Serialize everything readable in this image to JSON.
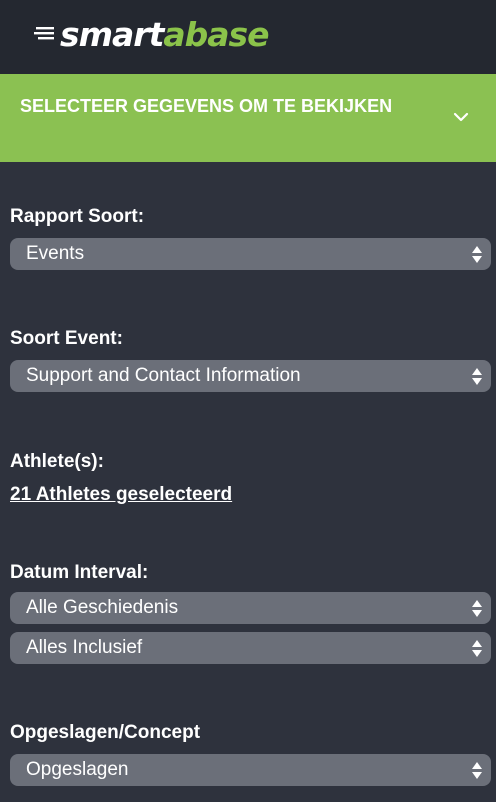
{
  "app": {
    "logo_part1": "smart",
    "logo_part2": "abase",
    "brand_color": "#8bc34a"
  },
  "banner": {
    "title": "SELECTEER GEGEVENS OM TE BEKIJKEN",
    "icon": "chevron-down-icon"
  },
  "form": {
    "report_type": {
      "label": "Rapport Soort:",
      "value": "Events"
    },
    "event_type": {
      "label": "Soort Event:",
      "value": "Support and Contact Information"
    },
    "athletes": {
      "label": "Athlete(s):",
      "link": "21 Athletes geselecteerd"
    },
    "date_interval": {
      "label": "Datum Interval:",
      "range_value": "Alle Geschiedenis",
      "inclusion_value": "Alles Inclusief"
    },
    "saved_draft": {
      "label": "Opgeslagen/Concept",
      "value": "Opgeslagen"
    }
  },
  "icons": {
    "select_arrows": "updown-arrows-icon"
  }
}
